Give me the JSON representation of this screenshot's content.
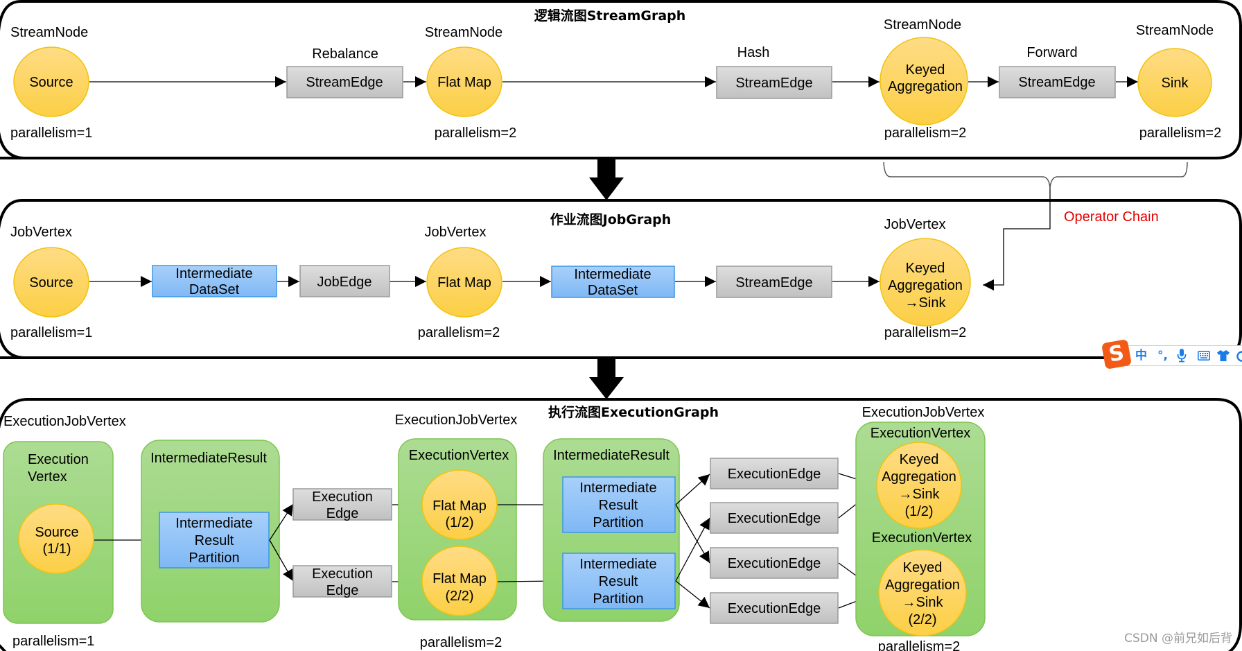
{
  "stream_graph": {
    "title": "逻辑流图StreamGraph",
    "nodes": [
      {
        "type_label": "StreamNode",
        "name": "Source",
        "parallelism": "parallelism=1"
      },
      {
        "type_label": "StreamNode",
        "name": "Flat Map",
        "parallelism": "parallelism=2"
      },
      {
        "type_label": "StreamNode",
        "name_lines": [
          "Keyed",
          "Aggregation"
        ],
        "parallelism": "parallelism=2"
      },
      {
        "type_label": "StreamNode",
        "name": "Sink",
        "parallelism": "parallelism=2"
      }
    ],
    "edges": [
      {
        "partitioner": "Rebalance",
        "label": "StreamEdge"
      },
      {
        "partitioner": "Hash",
        "label": "StreamEdge"
      },
      {
        "partitioner": "Forward",
        "label": "StreamEdge"
      }
    ],
    "operator_chain_label": "Operator Chain"
  },
  "job_graph": {
    "title": "作业流图JobGraph",
    "nodes": [
      {
        "type_label": "JobVertex",
        "name": "Source",
        "parallelism": "parallelism=1"
      },
      {
        "type_label": "JobVertex",
        "name": "Flat Map",
        "parallelism": "parallelism=2"
      },
      {
        "type_label": "JobVertex",
        "name_lines": [
          "Keyed",
          "Aggregation",
          "→Sink"
        ],
        "parallelism": "parallelism=2"
      }
    ],
    "datasets": [
      {
        "lines": [
          "Intermediate",
          "DataSet"
        ]
      },
      {
        "lines": [
          "Intermediate",
          "DataSet"
        ]
      }
    ],
    "edges": [
      {
        "label": "JobEdge"
      },
      {
        "label": "StreamEdge"
      }
    ]
  },
  "execution_graph": {
    "title": "执行流图ExecutionGraph",
    "job_vertex_label": "ExecutionJobVertex",
    "source_group": {
      "vertex_label_lines": [
        "Execution",
        "Vertex"
      ],
      "node_lines": [
        "Source",
        "(1/1)"
      ],
      "parallelism": "parallelism=1"
    },
    "result_group_1": {
      "label": "IntermediateResult",
      "partition_lines": [
        "Intermediate",
        "Result",
        "Partition"
      ]
    },
    "execution_edges_1": [
      {
        "lines": [
          "Execution",
          "Edge"
        ]
      },
      {
        "lines": [
          "Execution",
          "Edge"
        ]
      }
    ],
    "flatmap_group": {
      "vertex_label": "ExecutionVertex",
      "nodes": [
        {
          "lines": [
            "Flat Map",
            "(1/2)"
          ]
        },
        {
          "lines": [
            "Flat Map",
            "(2/2)"
          ]
        }
      ],
      "parallelism": "parallelism=2"
    },
    "result_group_2": {
      "label": "IntermediateResult",
      "partitions": [
        {
          "lines": [
            "Intermediate",
            "Result",
            "Partition"
          ]
        },
        {
          "lines": [
            "Intermediate",
            "Result",
            "Partition"
          ]
        }
      ]
    },
    "execution_edges_2": [
      "ExecutionEdge",
      "ExecutionEdge",
      "ExecutionEdge",
      "ExecutionEdge"
    ],
    "sink_group": {
      "vertex_labels": [
        "ExecutionVertex",
        "ExecutionVertex"
      ],
      "nodes": [
        {
          "lines": [
            "Keyed",
            "Aggregation",
            "→Sink",
            "(1/2)"
          ]
        },
        {
          "lines": [
            "Keyed",
            "Aggregation",
            "→Sink",
            "(2/2)"
          ]
        }
      ],
      "parallelism": "parallelism=2"
    }
  },
  "ime_toolbar": {
    "logo": "S",
    "icons": [
      {
        "name": "chinese-mode-icon",
        "glyph": "中"
      },
      {
        "name": "punctuation-icon",
        "glyph": "°,"
      },
      {
        "name": "microphone-icon",
        "glyph": "🎤"
      },
      {
        "name": "keyboard-icon",
        "glyph": "⌨"
      },
      {
        "name": "skin-shirt-icon",
        "glyph": "👕"
      }
    ]
  },
  "watermark": "CSDN @前兄如后背",
  "colors": {
    "operator_chain": "#e60000",
    "node_fill": "#fdd35c",
    "edge_box_fill": "#cfcfcf",
    "dataset_fill": "#9cc8f7",
    "group_fill": "#97d36f",
    "ime_accent": "#1a7ce8",
    "ime_logo": "#f25a16"
  }
}
